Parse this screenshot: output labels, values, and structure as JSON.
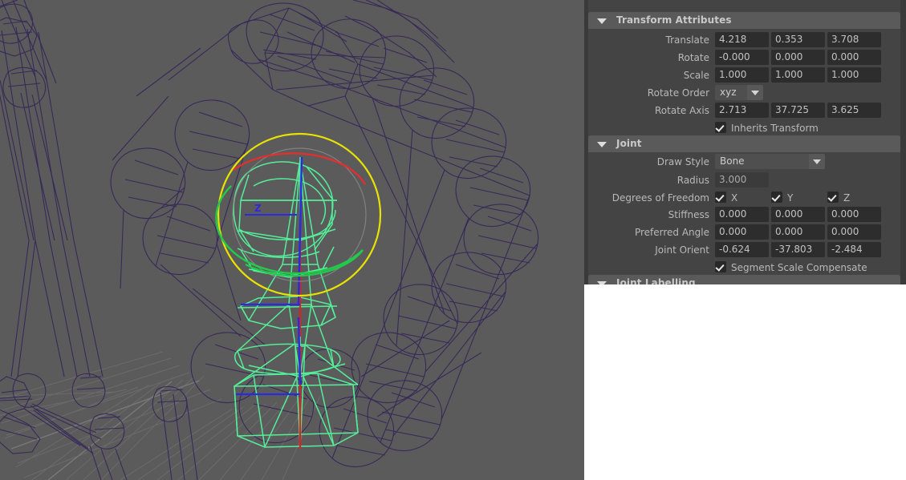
{
  "viewport": {
    "name": "maya-3d-viewport",
    "background_color": "#5b5b5b",
    "wireframe_color": "#382a58",
    "selected_color": "#55ee99",
    "grid_color": "#6a6a6a",
    "manipulator": {
      "outer_ring_color": "#e8e200",
      "x_ring_color": "#e03030",
      "y_ring_color": "#22c94c",
      "z_axis_color": "#2a2ae0",
      "z_label": "Z"
    }
  },
  "panel": {
    "name": "attribute-editor",
    "sections": [
      {
        "id": "transform_attributes",
        "title": "Transform Attributes",
        "expanded": true
      },
      {
        "id": "joint",
        "title": "Joint",
        "expanded": true
      },
      {
        "id": "joint_labelling",
        "title": "Joint Labelling",
        "expanded": true
      }
    ],
    "transform": {
      "translate": {
        "label": "Translate",
        "x": "4.218",
        "y": "0.353",
        "z": "3.708"
      },
      "rotate": {
        "label": "Rotate",
        "x": "-0.000",
        "y": "0.000",
        "z": "0.000"
      },
      "scale": {
        "label": "Scale",
        "x": "1.000",
        "y": "1.000",
        "z": "1.000"
      },
      "rotate_order": {
        "label": "Rotate Order",
        "value": "xyz"
      },
      "rotate_axis": {
        "label": "Rotate Axis",
        "x": "2.713",
        "y": "37.725",
        "z": "3.625"
      },
      "inherits_transform": {
        "label": "Inherits Transform",
        "checked": true
      }
    },
    "joint": {
      "draw_style": {
        "label": "Draw Style",
        "value": "Bone"
      },
      "radius": {
        "label": "Radius",
        "value": "3.000"
      },
      "degrees_of_freedom": {
        "label": "Degrees of Freedom",
        "x_label": "X",
        "y_label": "Y",
        "z_label": "Z",
        "x_checked": true,
        "y_checked": true,
        "z_checked": true
      },
      "stiffness": {
        "label": "Stiffness",
        "x": "0.000",
        "y": "0.000",
        "z": "0.000"
      },
      "preferred_angle": {
        "label": "Preferred Angle",
        "x": "0.000",
        "y": "0.000",
        "z": "0.000"
      },
      "joint_orient": {
        "label": "Joint Orient",
        "x": "-0.624",
        "y": "-37.803",
        "z": "-2.484"
      },
      "segment_scale_compensate": {
        "label": "Segment Scale Compensate",
        "checked": true
      }
    }
  }
}
